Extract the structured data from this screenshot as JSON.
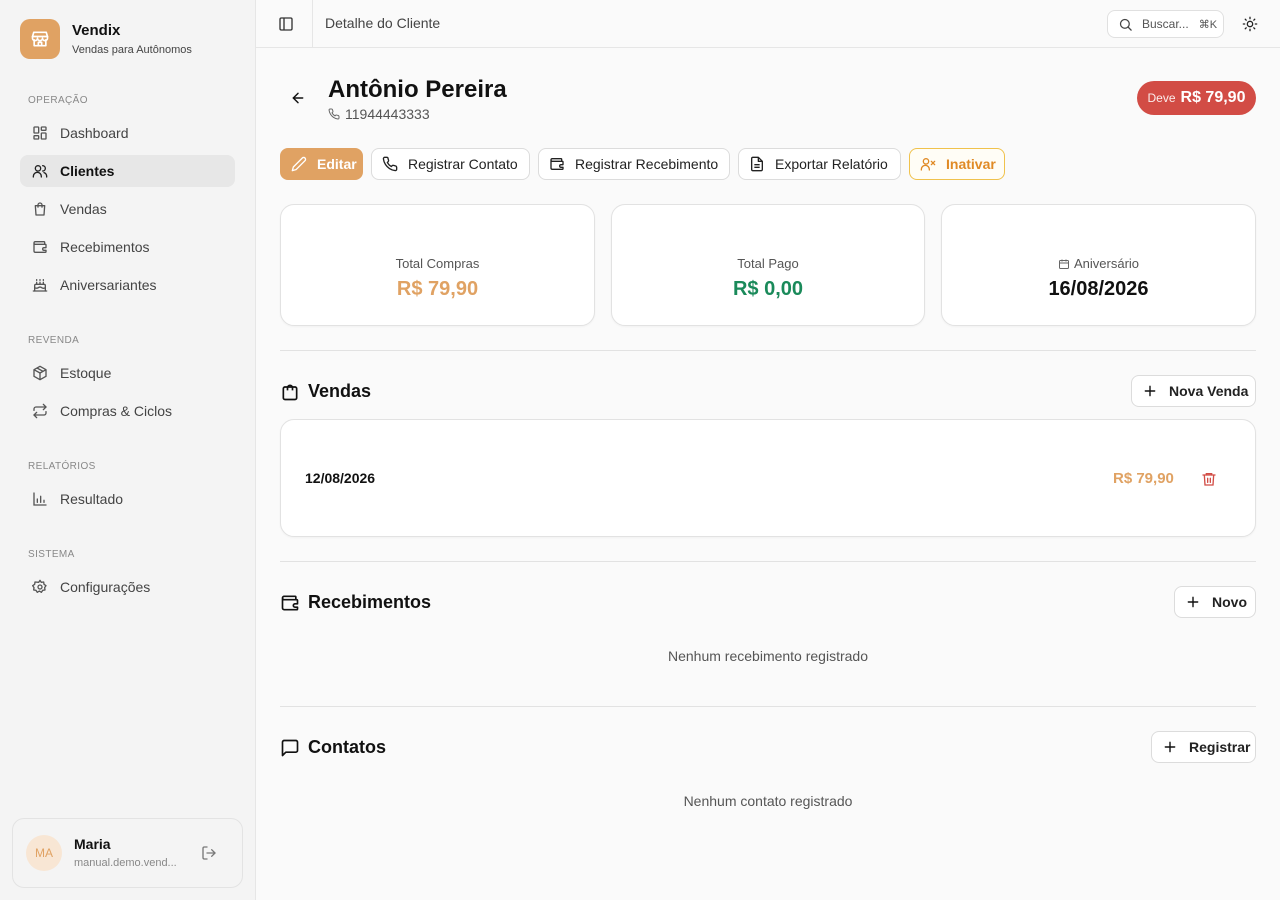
{
  "brand": {
    "name": "Vendix",
    "subtitle": "Vendas para Autônomos",
    "logo_icon": "store-icon",
    "accent": "#e0a263"
  },
  "sidebar": {
    "sections": [
      {
        "title": "OPERAÇÃO",
        "items": [
          {
            "label": "Dashboard",
            "icon": "layout-grid-icon",
            "active": false
          },
          {
            "label": "Clientes",
            "icon": "users-icon",
            "active": true
          },
          {
            "label": "Vendas",
            "icon": "shopping-bag-icon",
            "active": false
          },
          {
            "label": "Recebimentos",
            "icon": "wallet-icon",
            "active": false
          },
          {
            "label": "Aniversariantes",
            "icon": "cake-icon",
            "active": false
          }
        ]
      },
      {
        "title": "REVENDA",
        "items": [
          {
            "label": "Estoque",
            "icon": "package-icon",
            "active": false
          },
          {
            "label": "Compras & Ciclos",
            "icon": "repeat-icon",
            "active": false
          }
        ]
      },
      {
        "title": "RELATÓRIOS",
        "items": [
          {
            "label": "Resultado",
            "icon": "bar-chart-icon",
            "active": false
          }
        ]
      },
      {
        "title": "SISTEMA",
        "items": [
          {
            "label": "Configurações",
            "icon": "settings-icon",
            "active": false
          }
        ]
      }
    ]
  },
  "user": {
    "initials": "MA",
    "name": "Maria",
    "email": "manual.demo.vend..."
  },
  "header": {
    "title": "Detalhe do Cliente",
    "search_label": "Buscar...",
    "search_shortcut": "⌘K"
  },
  "customer": {
    "name": "Antônio Pereira",
    "phone": "11944443333",
    "debt_label": "Deve",
    "debt_value": "R$ 79,90"
  },
  "actions": {
    "edit": "Editar",
    "register_contact": "Registrar Contato",
    "register_payment": "Registrar Recebimento",
    "export_report": "Exportar Relatório",
    "deactivate": "Inativar"
  },
  "stats": {
    "total_purchases": {
      "label": "Total Compras",
      "value": "R$ 79,90",
      "color": "#e0a263"
    },
    "total_paid": {
      "label": "Total Pago",
      "value": "R$ 0,00",
      "color": "#1a8a5a"
    },
    "birthday": {
      "label": "Aniversário",
      "value": "16/08/2026",
      "color": "#111111"
    }
  },
  "sales": {
    "title": "Vendas",
    "new_label": "Nova Venda",
    "items": [
      {
        "date": "12/08/2026",
        "value": "R$ 79,90"
      }
    ]
  },
  "payments": {
    "title": "Recebimentos",
    "new_label": "Novo",
    "empty": "Nenhum recebimento registrado"
  },
  "contacts": {
    "title": "Contatos",
    "new_label": "Registrar",
    "empty": "Nenhum contato registrado"
  },
  "colors": {
    "danger": "#d24c45",
    "warning_border": "#f0c24c",
    "warning_text": "#e08a25"
  }
}
